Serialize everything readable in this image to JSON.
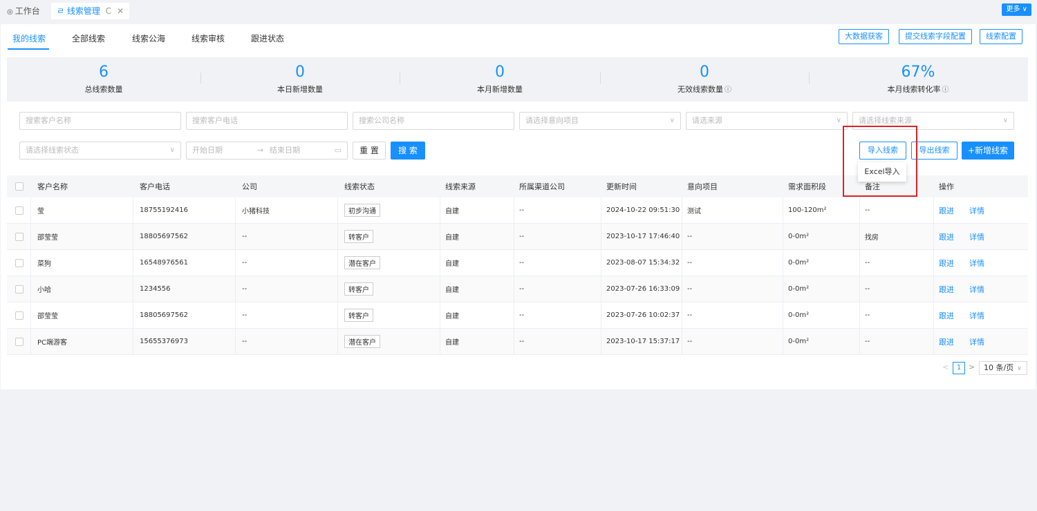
{
  "tabs": {
    "work": "工作台",
    "active": "线索管理",
    "more": "更多"
  },
  "subtabs": [
    "我的线索",
    "全部线索",
    "线索公海",
    "线索审核",
    "跟进状态"
  ],
  "top_buttons": [
    "大数据获客",
    "提交线索字段配置",
    "线索配置"
  ],
  "stats": [
    {
      "num": "6",
      "label": "总线索数量"
    },
    {
      "num": "0",
      "label": "本日新增数量"
    },
    {
      "num": "0",
      "label": "本月新增数量"
    },
    {
      "num": "0",
      "label": "无效线索数量"
    },
    {
      "num": "67%",
      "label": "本月线索转化率"
    }
  ],
  "filters": {
    "customer_name": "搜索客户名称",
    "customer_phone": "搜索客户电话",
    "company": "搜索公司名称",
    "project": "请选择意向项目",
    "source": "请选来源",
    "lead_source": "请选择线索来源",
    "status": "请选择线索状态",
    "start_date": "开始日期",
    "end_date": "结束日期",
    "reset": "重 置",
    "search": "搜 索"
  },
  "actions": {
    "import": "导入线索",
    "export": "导出线索",
    "add": "+新增线索",
    "excel_import": "Excel导入"
  },
  "table": {
    "headers": [
      "客户名称",
      "客户电话",
      "公司",
      "线索状态",
      "线索来源",
      "所属渠道公司",
      "更新时间",
      "意向项目",
      "需求面积段",
      "备注",
      "操作"
    ],
    "rows": [
      {
        "name": "莹",
        "phone": "18755192416",
        "company": "小猪科技",
        "status": "初步沟通",
        "source": "自建",
        "channel": "--",
        "updated": "2024-10-22 09:51:30",
        "project": "测试",
        "area": "100-120m²",
        "remark": "--"
      },
      {
        "name": "邵莹莹",
        "phone": "18805697562",
        "company": "--",
        "status": "转客户",
        "source": "自建",
        "channel": "--",
        "updated": "2023-10-17 17:46:40",
        "project": "--",
        "area": "0-0m²",
        "remark": "找房"
      },
      {
        "name": "菜狗",
        "phone": "16548976561",
        "company": "--",
        "status": "潜在客户",
        "source": "自建",
        "channel": "--",
        "updated": "2023-08-07 15:34:32",
        "project": "--",
        "area": "0-0m²",
        "remark": "--"
      },
      {
        "name": "小哈",
        "phone": "1234556",
        "company": "--",
        "status": "转客户",
        "source": "自建",
        "channel": "--",
        "updated": "2023-07-26 16:33:09",
        "project": "--",
        "area": "0-0m²",
        "remark": "--"
      },
      {
        "name": "邵莹莹",
        "phone": "18805697562",
        "company": "--",
        "status": "转客户",
        "source": "自建",
        "channel": "--",
        "updated": "2023-07-26 10:02:37",
        "project": "--",
        "area": "0-0m²",
        "remark": "--"
      },
      {
        "name": "PC端游客",
        "phone": "15655376973",
        "company": "--",
        "status": "潜在客户",
        "source": "自建",
        "channel": "--",
        "updated": "2023-10-17 15:37:17",
        "project": "--",
        "area": "0-0m²",
        "remark": "--"
      }
    ],
    "follow_label": "跟进",
    "detail_label": "详情"
  },
  "pagination": {
    "current": "1",
    "page_size": "10 条/页"
  }
}
